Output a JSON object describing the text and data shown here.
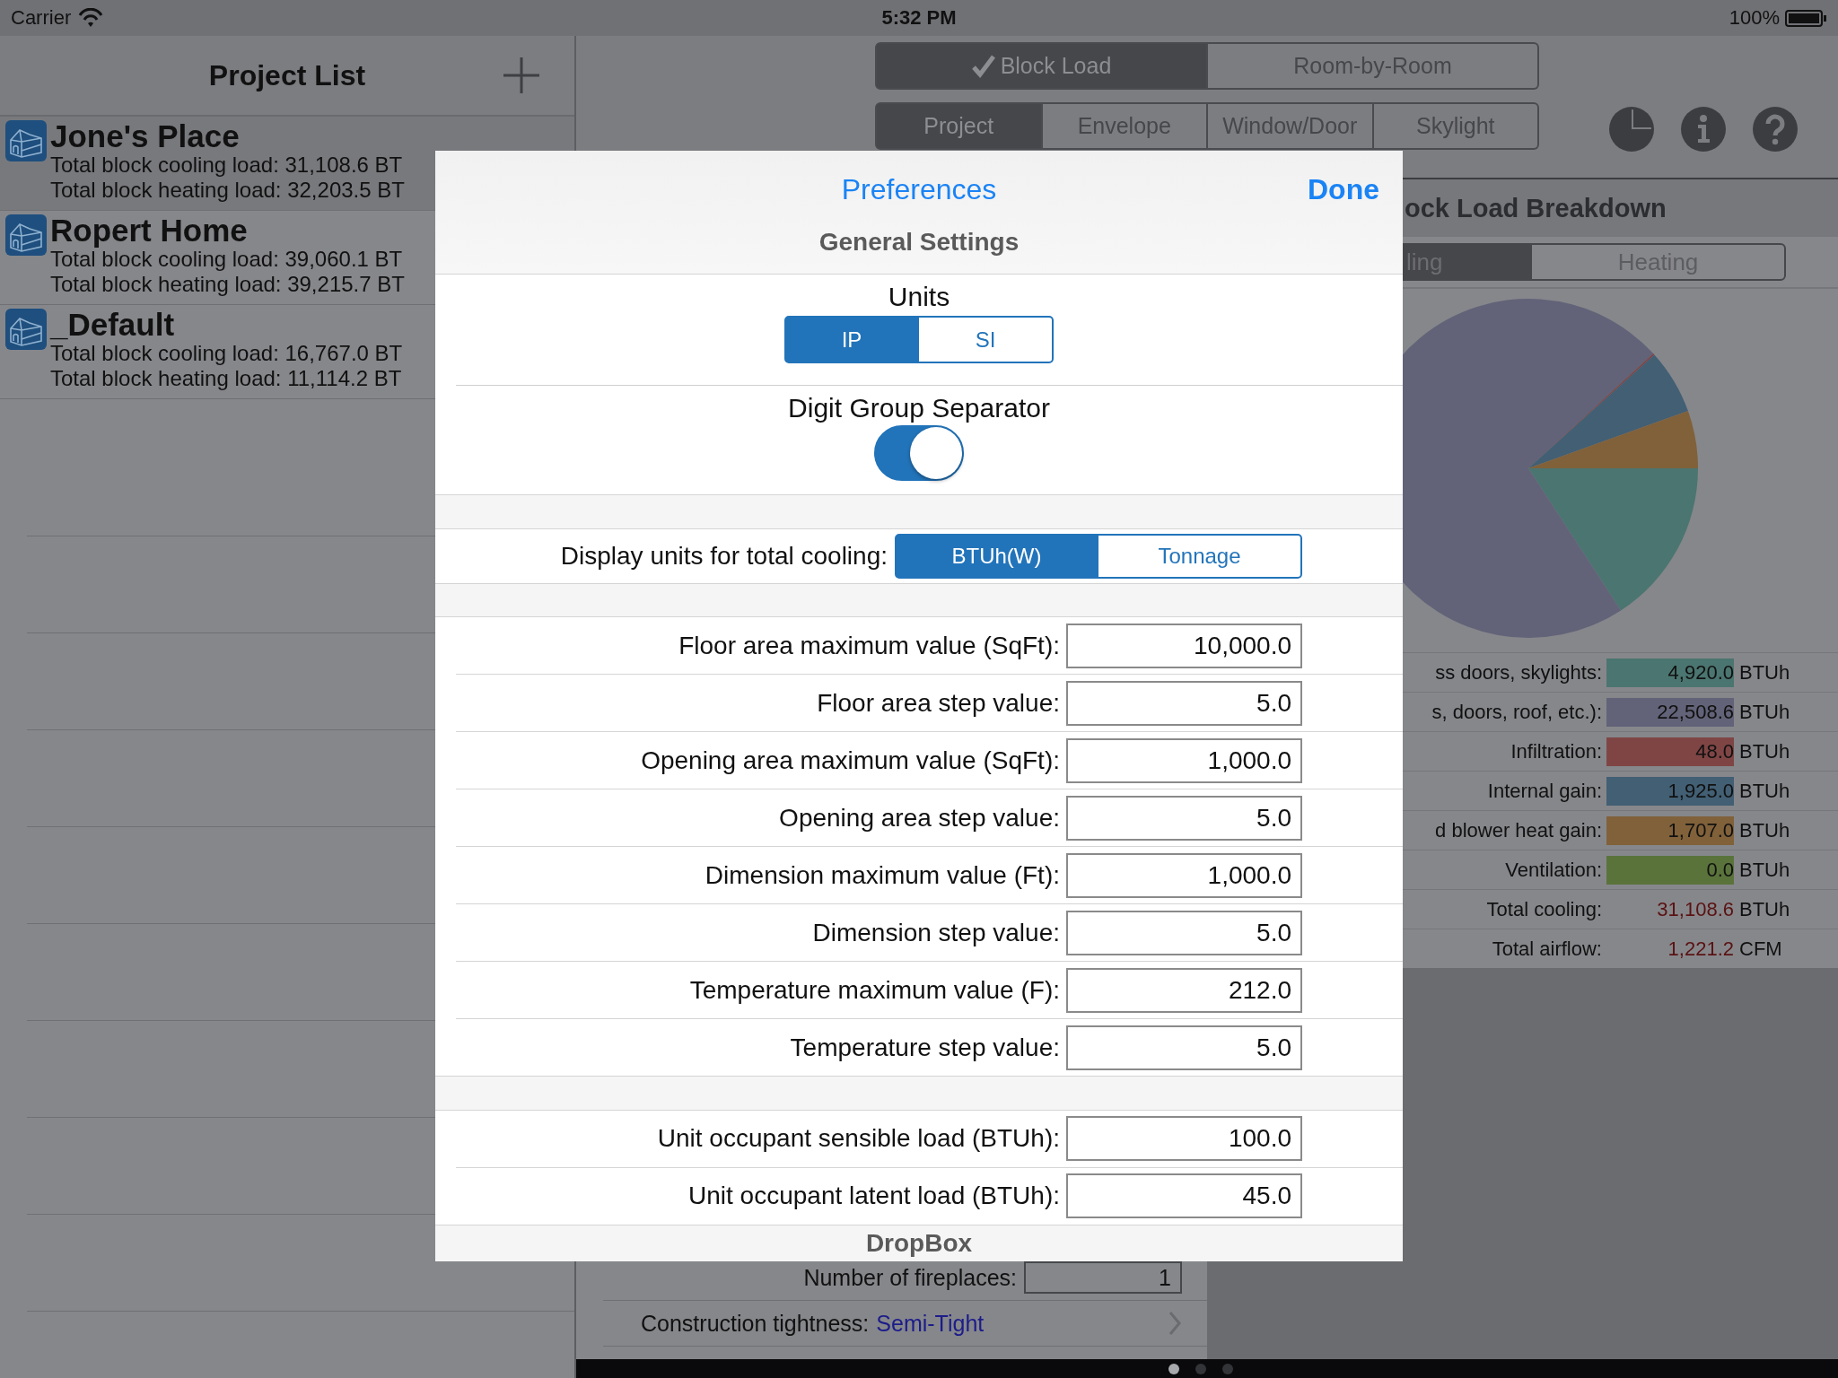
{
  "status_bar": {
    "carrier": "Carrier",
    "time": "5:32 PM",
    "battery": "100%"
  },
  "sidebar": {
    "title": "Project List",
    "items": [
      {
        "name": "Jone's Place",
        "cooling": "Total block cooling load: 31,108.6 BT",
        "heating": "Total block heating load: 32,203.5 BT",
        "selected": true
      },
      {
        "name": "Ropert Home",
        "cooling": "Total block cooling load: 39,060.1 BT",
        "heating": "Total block heating load: 39,215.7 BT",
        "selected": false
      },
      {
        "name": "_Default",
        "cooling": "Total block cooling load: 16,767.0 BT",
        "heating": "Total block heating load: 11,114.2 BT",
        "selected": false
      }
    ]
  },
  "mode_tabs": [
    {
      "label": "Block Load",
      "selected": true
    },
    {
      "label": "Room-by-Room",
      "selected": false
    }
  ],
  "section_tabs": [
    {
      "label": "Project",
      "selected": true
    },
    {
      "label": "Envelope",
      "selected": false
    },
    {
      "label": "Window/Door",
      "selected": false
    },
    {
      "label": "Skylight",
      "selected": false
    }
  ],
  "breakdown": {
    "title": "ock Load Breakdown",
    "tabs": [
      {
        "label": "ling",
        "selected": true
      },
      {
        "label": "Heating",
        "selected": false
      }
    ],
    "rows": [
      {
        "kind": "swatch",
        "label": "ss doors, skylights:",
        "value": "4,920.0",
        "unit": "BTUh",
        "color": "#4b7570"
      },
      {
        "kind": "swatch",
        "label": "s, doors, roof, etc.):",
        "value": "22,508.6",
        "unit": "BTUh",
        "color": "#626378"
      },
      {
        "kind": "swatch",
        "label": "Infiltration:",
        "value": "48.0",
        "unit": "BTUh",
        "color": "#7f4545"
      },
      {
        "kind": "swatch",
        "label": "Internal gain:",
        "value": "1,925.0",
        "unit": "BTUh",
        "color": "#425f74"
      },
      {
        "kind": "swatch",
        "label": "d blower heat gain:",
        "value": "1,707.0",
        "unit": "BTUh",
        "color": "#80613a"
      },
      {
        "kind": "swatch",
        "label": "Ventilation:",
        "value": "0.0",
        "unit": "BTUh",
        "color": "#5a733b"
      },
      {
        "kind": "total",
        "label": "Total cooling:",
        "value": "31,108.6",
        "unit": "BTUh"
      },
      {
        "kind": "total",
        "label": "Total airflow:",
        "value": "1,221.2",
        "unit": "CFM"
      }
    ]
  },
  "project_form": {
    "rows": [
      {
        "kind": "field",
        "label": "Number of fireplaces:",
        "value": "1"
      },
      {
        "kind": "choice",
        "label": "Construction tightness:",
        "value": "Semi-Tight"
      }
    ]
  },
  "pagination": {
    "dots": [
      {
        "selected": true
      },
      {
        "selected": false
      },
      {
        "selected": false
      }
    ]
  },
  "preferences": {
    "title": "Preferences",
    "done": "Done",
    "header": "General Settings",
    "units": {
      "label": "Units",
      "options": [
        {
          "label": "IP",
          "selected": true
        },
        {
          "label": "SI",
          "selected": false
        }
      ]
    },
    "digit_separator": {
      "label": "Digit Group Separator",
      "on": true
    },
    "cooling_units": {
      "label": "Display units for total cooling:",
      "options": [
        {
          "label": "BTUh(W)",
          "selected": true
        },
        {
          "label": "Tonnage",
          "selected": false
        }
      ]
    },
    "field_groups": [
      [
        {
          "label": "Floor area maximum value (SqFt):",
          "value": "10,000.0"
        },
        {
          "label": "Floor area step value:",
          "value": "5.0"
        },
        {
          "label": "Opening area maximum value (SqFt):",
          "value": "1,000.0"
        },
        {
          "label": "Opening area step value:",
          "value": "5.0"
        },
        {
          "label": "Dimension maximum value (Ft):",
          "value": "1,000.0"
        },
        {
          "label": "Dimension step value:",
          "value": "5.0"
        },
        {
          "label": "Temperature maximum value (F):",
          "value": "212.0"
        },
        {
          "label": "Temperature step value:",
          "value": "5.0"
        }
      ],
      [
        {
          "label": "Unit occupant sensible load (BTUh):",
          "value": "100.0"
        },
        {
          "label": "Unit occupant latent load (BTUh):",
          "value": "45.0"
        }
      ]
    ],
    "footer": "DropBox"
  }
}
